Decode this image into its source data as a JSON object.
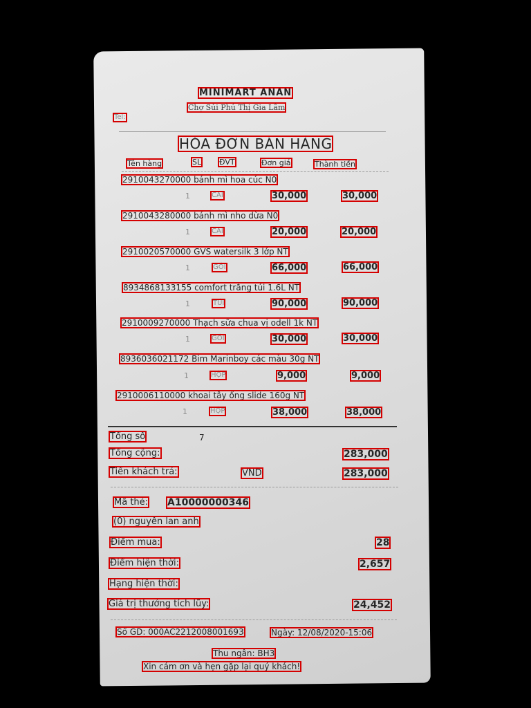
{
  "store": {
    "name": "MINIMART ANAN",
    "address": "Chợ Sủi Phú Thị Gia Lâm",
    "phone_label": "Tel:"
  },
  "invoice": {
    "title": "HÓA ĐƠN BÁN HÀNG",
    "headers": [
      "Tên hàng",
      "SL",
      "ĐVT",
      "Đơn giá",
      "Thành tiền"
    ]
  },
  "items": [
    {
      "name": "2910043270000 bánh mì hoa cúc N0",
      "qty": "1",
      "unit": "CÁI",
      "price": "30,000",
      "total": "30,000"
    },
    {
      "name": "2910043280000 bánh mì nho dừa N0",
      "qty": "1",
      "unit": "CÁI",
      "price": "20,000",
      "total": "20,000"
    },
    {
      "name": "2910020570000 GVS watersilk 3 lớp NT",
      "qty": "1",
      "unit": "GÓI",
      "price": "66,000",
      "total": "66,000"
    },
    {
      "name": "8934868133155 comfort trắng túi 1.6L NT",
      "qty": "1",
      "unit": "TÚI",
      "price": "90,000",
      "total": "90,000"
    },
    {
      "name": "2910009270000 Thạch sữa chua vị odell 1k NT",
      "qty": "1",
      "unit": "GÓI",
      "price": "30,000",
      "total": "30,000"
    },
    {
      "name": "8936036021172 Bim Marinboy các màu 30g NT",
      "qty": "1",
      "unit": "HỘP",
      "price": "9,000",
      "total": "9,000"
    },
    {
      "name": "2910006110000 khoai tây ống slide 160g NT",
      "qty": "1",
      "unit": "HỘP",
      "price": "38,000",
      "total": "38,000"
    }
  ],
  "summary": {
    "count_label": "Tổng số",
    "count_value": "7",
    "subtotal_label": "Tổng cộng:",
    "subtotal_value": "283,000",
    "paid_label": "Tiền khách trả:",
    "currency": "VND",
    "paid_value": "283,000"
  },
  "member": {
    "card_label": "Mã thẻ:",
    "card_value": "A10000000346",
    "name": "(0) nguyễn lan anh",
    "points_label": "Điểm mua:",
    "points_value": "28",
    "current_points_label": "Điểm hiện thời:",
    "current_points_value": "2,657",
    "rank_label": "Hạng hiện thời:",
    "accumulated_label": "Giá trị thưởng tích lũy:",
    "accumulated_value": "24,452"
  },
  "footer": {
    "transaction": "Số GD: 000AC2212008001693",
    "date": "Ngày: 12/08/2020-15:06",
    "cashier": "Thu ngân: BH3",
    "thanks": "Xin cám ơn và hẹn gặp lại quý khách!"
  },
  "colors": {
    "background": "#000000",
    "paper": "#e2e2e2",
    "ink": "#262626",
    "faint_ink": "#8c8c8c",
    "annotation_box": "#d40000"
  }
}
